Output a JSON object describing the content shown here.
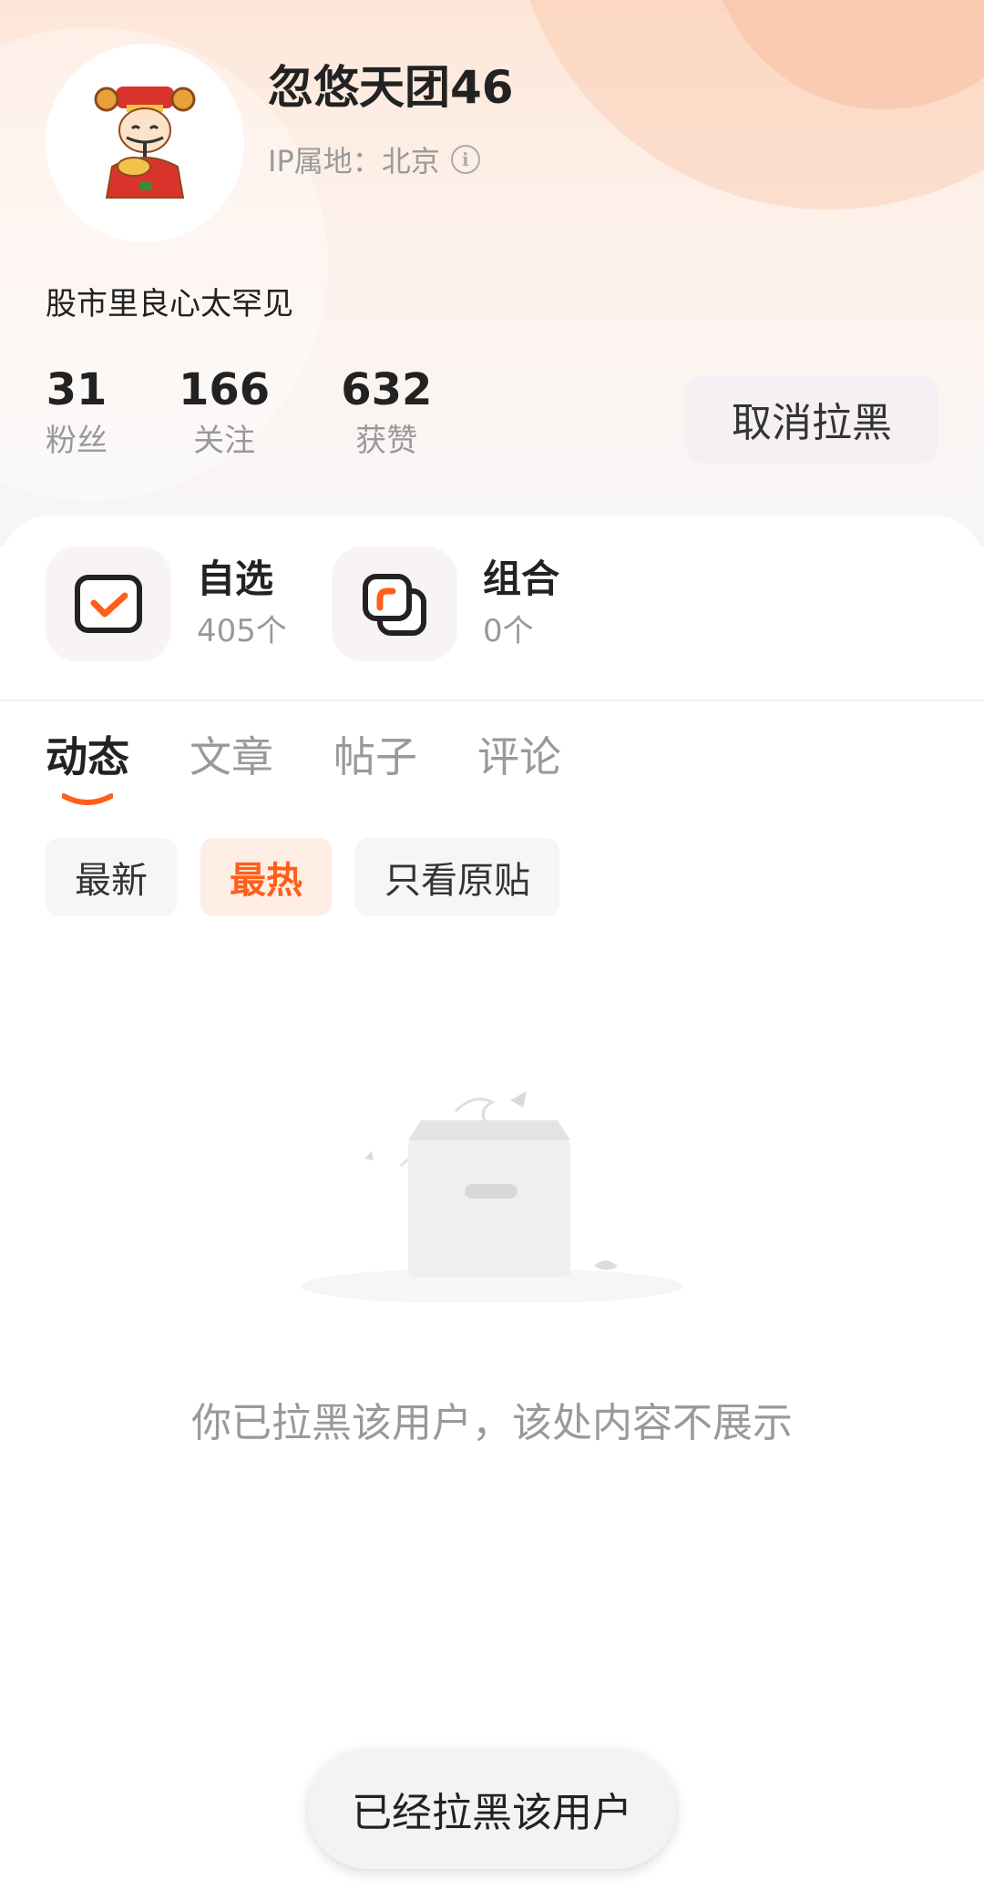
{
  "profile": {
    "username": "忽悠天团46",
    "ip_label": "IP属地：北京",
    "bio": "股市里良心太罕见"
  },
  "stats": [
    {
      "value": "31",
      "label": "粉丝"
    },
    {
      "value": "166",
      "label": "关注"
    },
    {
      "value": "632",
      "label": "获赞"
    }
  ],
  "actions": {
    "unblock_label": "取消拉黑"
  },
  "shortcuts": [
    {
      "title": "自选",
      "count": "405个",
      "icon": "checkbox-icon"
    },
    {
      "title": "组合",
      "count": "0个",
      "icon": "portfolio-icon"
    }
  ],
  "tabs": [
    {
      "label": "动态",
      "active": true
    },
    {
      "label": "文章",
      "active": false
    },
    {
      "label": "帖子",
      "active": false
    },
    {
      "label": "评论",
      "active": false
    }
  ],
  "filters": [
    {
      "label": "最新",
      "active": false
    },
    {
      "label": "最热",
      "active": true
    },
    {
      "label": "只看原贴",
      "active": false
    }
  ],
  "empty_state": {
    "message": "你已拉黑该用户，该处内容不展示",
    "icon": "empty-box-icon"
  },
  "toast": {
    "message": "已经拉黑该用户"
  },
  "colors": {
    "accent": "#ff5f1a",
    "header_gradient_top": "#fde6d8"
  }
}
